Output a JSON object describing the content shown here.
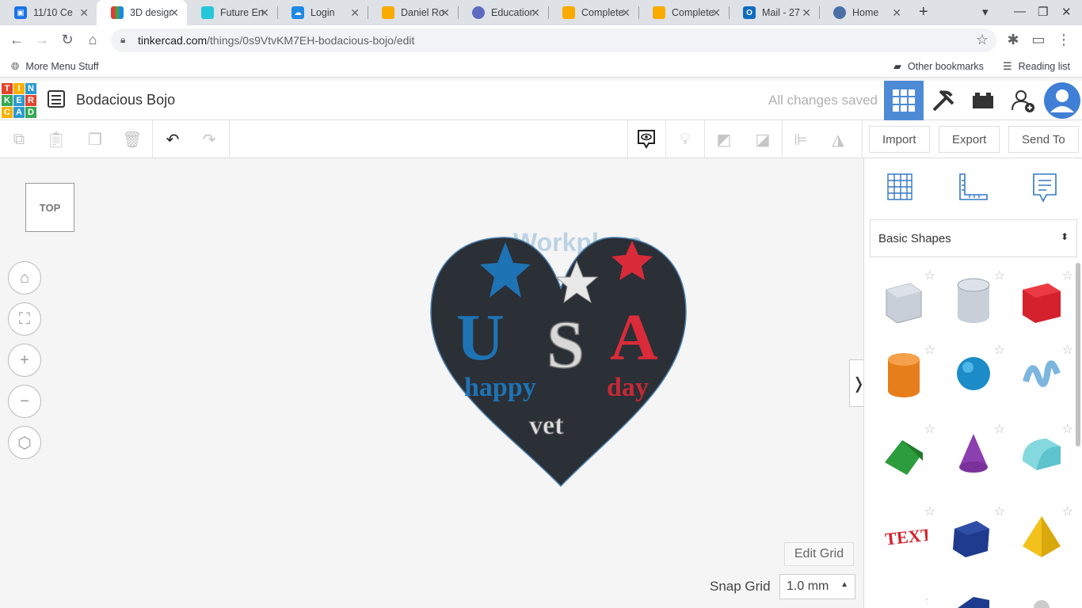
{
  "browser": {
    "tabs": [
      {
        "title": "11/10 Ce",
        "color": "#1a73e8",
        "active": false
      },
      {
        "title": "3D design",
        "color": "#e53935",
        "active": true
      },
      {
        "title": "Future En",
        "color": "#26c6da",
        "active": false
      },
      {
        "title": "Login",
        "color": "#1e88e5",
        "active": false
      },
      {
        "title": "Daniel Ro",
        "color": "#f9ab00",
        "active": false
      },
      {
        "title": "Education",
        "color": "#5c6bc0",
        "active": false
      },
      {
        "title": "Complete",
        "color": "#f9ab00",
        "active": false
      },
      {
        "title": "Complete",
        "color": "#f9ab00",
        "active": false
      },
      {
        "title": "Mail - 27",
        "color": "#0f6cbd",
        "active": false
      },
      {
        "title": "Home",
        "color": "#4a6fa5",
        "active": false
      }
    ],
    "url_host": "tinkercad.com",
    "url_path": "/things/0s9VtvKM7EH-bodacious-bojo/edit",
    "bookmarks": {
      "left": "More Menu Stuff",
      "other": "Other bookmarks",
      "reading": "Reading list"
    }
  },
  "app": {
    "logo_letters": [
      "T",
      "I",
      "N",
      "K",
      "E",
      "R",
      "C",
      "A",
      "D"
    ],
    "design_title": "Bodacious Bojo",
    "save_status": "All changes saved",
    "toolbar": {
      "import": "Import",
      "export": "Export",
      "send_to": "Send To"
    },
    "viewcube": "TOP",
    "workplane_label": "Workplane",
    "edit_grid": "Edit Grid",
    "snap_grid_label": "Snap Grid",
    "snap_grid_value": "1.0 mm",
    "shape_category": "Basic Shapes",
    "design": {
      "big_letters": [
        "U",
        "S",
        "A"
      ],
      "words": [
        "happy",
        "vet",
        "day"
      ]
    }
  }
}
